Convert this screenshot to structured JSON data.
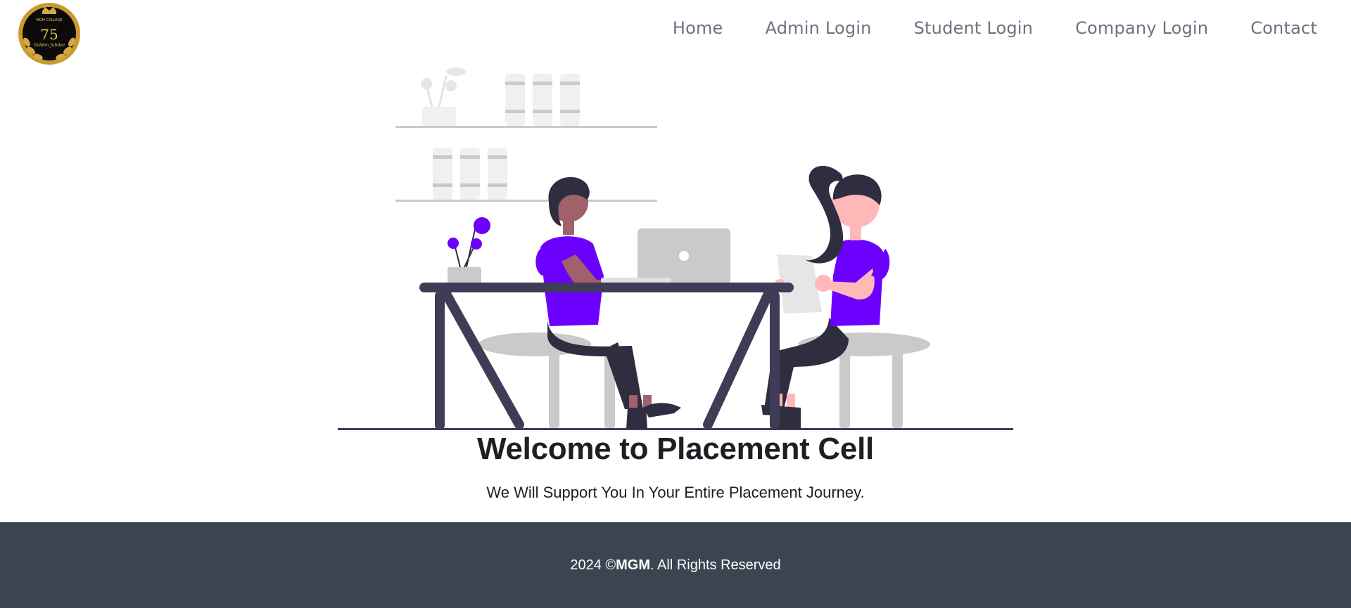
{
  "header": {
    "logo": {
      "icon": "college-emblem-logo",
      "number_text": "75",
      "top_text": "MGM COLLEGE",
      "script_text": "Golden Jubilee",
      "colors": {
        "ring": "#c99a2e",
        "inner": "#0b0b0b",
        "text": "#f1c75b"
      }
    },
    "nav": [
      {
        "name": "nav-home",
        "label": "Home"
      },
      {
        "name": "nav-admin-login",
        "label": "Admin Login"
      },
      {
        "name": "nav-student-login",
        "label": "Student Login"
      },
      {
        "name": "nav-company-login",
        "label": "Company Login"
      },
      {
        "name": "nav-contact",
        "label": "Contact"
      }
    ]
  },
  "hero": {
    "illustration": "two-people-working-at-desk-illustration",
    "title": "Welcome to Placement Cell",
    "subtitle": "We Will Support You In Your Entire Placement Journey.",
    "colors": {
      "accent": "#6c00ff",
      "dark": "#3f3d56",
      "grey": "#cacaca",
      "skin_light": "#ffb8b8",
      "skin_dark": "#a0616a",
      "hair": "#2f2e41"
    }
  },
  "footer": {
    "year": "2024",
    "copy_symbol": "©",
    "brand": "MGM",
    "rights": ". All Rights Reserved",
    "background": "#3b4552"
  }
}
